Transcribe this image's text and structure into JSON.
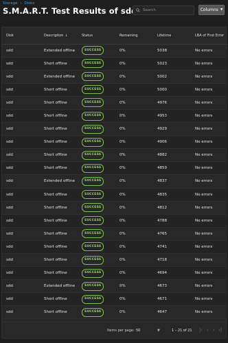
{
  "breadcrumb": {
    "items": [
      "Storage",
      "Disks"
    ]
  },
  "page": {
    "title": "S.M.A.R.T. Test Results of sdd"
  },
  "search": {
    "placeholder": "Search"
  },
  "toolbar": {
    "columns_label": "Columns"
  },
  "table": {
    "headers": [
      "Disk",
      "Description",
      "Status",
      "Remaining",
      "Lifetime",
      "LBA of First Error"
    ],
    "sort_column": "Description",
    "rows": [
      {
        "disk": "sdd",
        "description": "Extended offline",
        "status": "SUCCESS",
        "remaining": "0%",
        "lifetime": "5038",
        "lba": "No errors"
      },
      {
        "disk": "sdd",
        "description": "Short offline",
        "status": "SUCCESS",
        "remaining": "0%",
        "lifetime": "5023",
        "lba": "No errors"
      },
      {
        "disk": "sdd",
        "description": "Extended offline",
        "status": "SUCCESS",
        "remaining": "0%",
        "lifetime": "5002",
        "lba": "No errors"
      },
      {
        "disk": "sdd",
        "description": "Short offline",
        "status": "SUCCESS",
        "remaining": "0%",
        "lifetime": "5000",
        "lba": "No errors"
      },
      {
        "disk": "sdd",
        "description": "Short offline",
        "status": "SUCCESS",
        "remaining": "0%",
        "lifetime": "4976",
        "lba": "No errors"
      },
      {
        "disk": "sdd",
        "description": "Short offline",
        "status": "SUCCESS",
        "remaining": "0%",
        "lifetime": "4953",
        "lba": "No errors"
      },
      {
        "disk": "sdd",
        "description": "Short offline",
        "status": "SUCCESS",
        "remaining": "0%",
        "lifetime": "4929",
        "lba": "No errors"
      },
      {
        "disk": "sdd",
        "description": "Short offline",
        "status": "SUCCESS",
        "remaining": "0%",
        "lifetime": "4906",
        "lba": "No errors"
      },
      {
        "disk": "sdd",
        "description": "Short offline",
        "status": "SUCCESS",
        "remaining": "0%",
        "lifetime": "4882",
        "lba": "No errors"
      },
      {
        "disk": "sdd",
        "description": "Short offline",
        "status": "SUCCESS",
        "remaining": "0%",
        "lifetime": "4859",
        "lba": "No errors"
      },
      {
        "disk": "sdd",
        "description": "Extended offline",
        "status": "SUCCESS",
        "remaining": "0%",
        "lifetime": "4837",
        "lba": "No errors"
      },
      {
        "disk": "sdd",
        "description": "Short offline",
        "status": "SUCCESS",
        "remaining": "0%",
        "lifetime": "4835",
        "lba": "No errors"
      },
      {
        "disk": "sdd",
        "description": "Short offline",
        "status": "SUCCESS",
        "remaining": "0%",
        "lifetime": "4812",
        "lba": "No errors"
      },
      {
        "disk": "sdd",
        "description": "Short offline",
        "status": "SUCCESS",
        "remaining": "0%",
        "lifetime": "4788",
        "lba": "No errors"
      },
      {
        "disk": "sdd",
        "description": "Short offline",
        "status": "SUCCESS",
        "remaining": "0%",
        "lifetime": "4765",
        "lba": "No errors"
      },
      {
        "disk": "sdd",
        "description": "Short offline",
        "status": "SUCCESS",
        "remaining": "0%",
        "lifetime": "4741",
        "lba": "No errors"
      },
      {
        "disk": "sdd",
        "description": "Short offline",
        "status": "SUCCESS",
        "remaining": "0%",
        "lifetime": "4718",
        "lba": "No errors"
      },
      {
        "disk": "sdd",
        "description": "Short offline",
        "status": "SUCCESS",
        "remaining": "0%",
        "lifetime": "4694",
        "lba": "No errors"
      },
      {
        "disk": "sdd",
        "description": "Extended offline",
        "status": "SUCCESS",
        "remaining": "0%",
        "lifetime": "4673",
        "lba": "No errors"
      },
      {
        "disk": "sdd",
        "description": "Short offline",
        "status": "SUCCESS",
        "remaining": "0%",
        "lifetime": "4671",
        "lba": "No errors"
      },
      {
        "disk": "sdd",
        "description": "Short offline",
        "status": "SUCCESS",
        "remaining": "0%",
        "lifetime": "4647",
        "lba": "No errors"
      }
    ]
  },
  "pagination": {
    "items_per_page_label": "Items per page:",
    "items_per_page": "50",
    "range": "1 – 21 of 21"
  },
  "colors": {
    "background": "#1e1e1e",
    "card": "#282828",
    "link": "#3c9de0",
    "success": "#7bc24a"
  },
  "icons": [
    "search-icon",
    "chevron-down-icon",
    "sort-arrow-down-icon",
    "first-page-icon",
    "previous-page-icon",
    "next-page-icon",
    "last-page-icon"
  ]
}
